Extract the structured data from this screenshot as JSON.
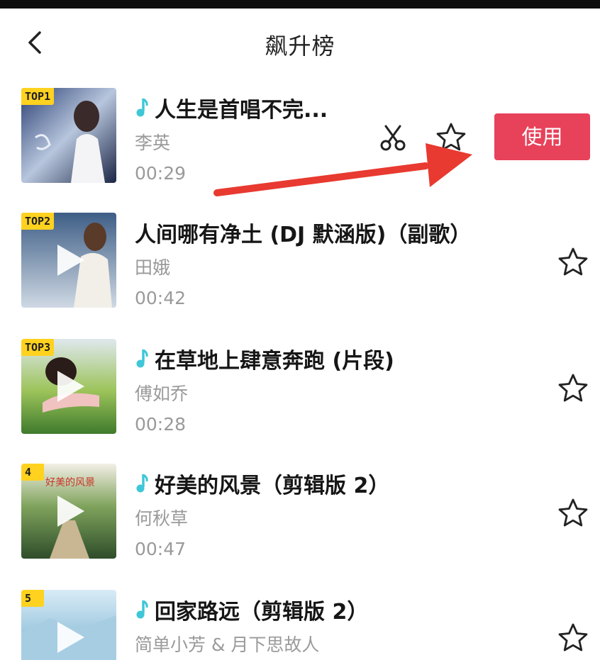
{
  "header": {
    "title": "飙升榜",
    "back_icon": "chevron-left-icon"
  },
  "colors": {
    "accent": "#e8415a",
    "badge": "#ffd21f",
    "note": "#3fc7d8",
    "arrow": "#e83a30"
  },
  "selected_row": {
    "use_label": "使用",
    "scissors_icon": "scissors-icon",
    "star_icon": "star-outline-icon"
  },
  "songs": [
    {
      "badge": "TOP1",
      "title": "人生是首唱不完...",
      "artist": "李英",
      "duration": "00:29",
      "note": true
    },
    {
      "badge": "TOP2",
      "title": "人间哪有净土 (DJ 默涵版)（副歌）",
      "artist": "田娥",
      "duration": "00:42",
      "note": false
    },
    {
      "badge": "TOP3",
      "title": "在草地上肆意奔跑 (片段)",
      "artist": "傅如乔",
      "duration": "00:28",
      "note": true
    },
    {
      "badge": "4",
      "title": "好美的风景（剪辑版 2）",
      "artist": "何秋草",
      "duration": "00:47",
      "note": true,
      "cover_text": "好美的风景"
    },
    {
      "badge": "5",
      "title": "回家路远（剪辑版 2）",
      "artist": "简单小芳 & 月下思故人",
      "duration": "",
      "note": true
    }
  ]
}
